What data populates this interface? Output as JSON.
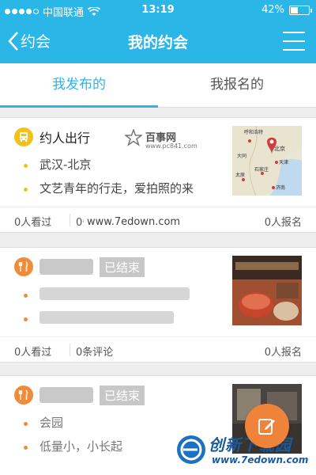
{
  "status_bar": {
    "carrier": "中国联通",
    "time": "13:19",
    "battery": "42%",
    "battery_level": 0.42
  },
  "nav": {
    "back_label": "约会",
    "title": "我的约会"
  },
  "tabs": [
    {
      "label": "我发布的",
      "active": true
    },
    {
      "label": "我报名的",
      "active": false
    }
  ],
  "cards": [
    {
      "category_icon": "bus-icon",
      "title": "约人出行",
      "lines": [
        "武汉-北京",
        "文艺青年的行走，爱拍照的来"
      ],
      "thumbnail": "map-thumbnail",
      "map_labels": [
        "呼和浩特",
        "北京",
        "天津",
        "大同",
        "石家庄",
        "太原",
        "济南"
      ],
      "views": "0人看过",
      "comments": "0条评论",
      "signups": "0人报名"
    },
    {
      "category_icon": "fork-knife-icon",
      "title": "",
      "status": "已结束",
      "lines": [],
      "thumbnail": "food-photo-thumbnail",
      "views": "0人看过",
      "comments": "0条评论",
      "signups": "0人报名"
    },
    {
      "category_icon": "fork-knife-icon",
      "title": "",
      "status": "已结束",
      "lines": [
        "会园",
        "低量小，小长起"
      ],
      "thumbnail": "building-photo-thumbnail"
    }
  ],
  "watermarks": {
    "baishi_title": "百事网",
    "baishi_url": "www.pc841.com",
    "site_url": "www.7edown.com",
    "bottom_brand": "创新下载园",
    "bottom_url": "www.7edown.com"
  },
  "colors": {
    "primary": "#2bb6e8",
    "accent_orange": "#ef8b3b",
    "accent_yellow": "#f2c21a"
  },
  "fab_icon": "edit-icon"
}
